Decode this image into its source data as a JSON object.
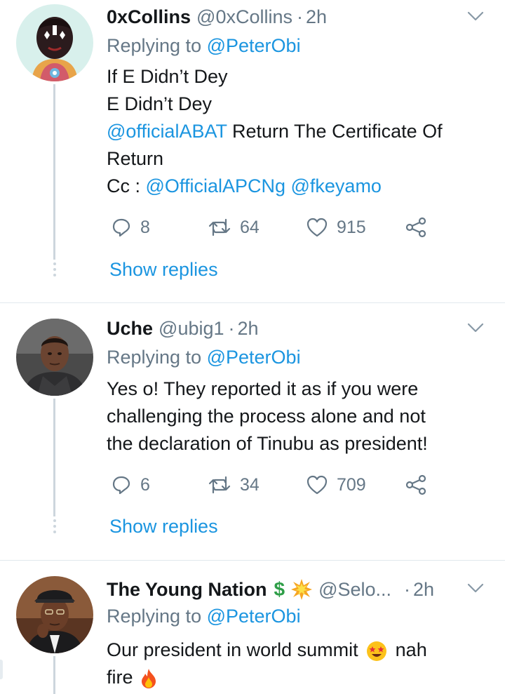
{
  "tweets": [
    {
      "name": "0xCollins",
      "handle": "@0xCollins",
      "sep": "·",
      "time": "2h",
      "replying_prefix": "Replying to",
      "replying_handle": "@PeterObi",
      "lines": [
        [
          {
            "t": "If E Didn’t Dey",
            "link": false
          }
        ],
        [
          {
            "t": "E Didn’t Dey",
            "link": false
          }
        ],
        [
          {
            "t": "@officialABAT",
            "link": true
          },
          {
            "t": " Return The Certificate Of",
            "link": false
          }
        ],
        [
          {
            "t": "Return",
            "link": false
          }
        ],
        [
          {
            "t": "Cc : ",
            "link": false
          },
          {
            "t": "@OfficialAPCNg",
            "link": true
          },
          {
            "t": " ",
            "link": false
          },
          {
            "t": "@fkeyamo",
            "link": true
          }
        ]
      ],
      "replies": "8",
      "retweets": "64",
      "likes": "915",
      "show_replies": "Show replies"
    },
    {
      "name": "Uche",
      "handle": "@ubig1",
      "sep": "·",
      "time": "2h",
      "replying_prefix": "Replying to",
      "replying_handle": "@PeterObi",
      "lines": [
        [
          {
            "t": "Yes o! They reported it as if you were",
            "link": false
          }
        ],
        [
          {
            "t": "challenging the process alone and not",
            "link": false
          }
        ],
        [
          {
            "t": "the declaration of Tinubu as president!",
            "link": false
          }
        ]
      ],
      "replies": "6",
      "retweets": "34",
      "likes": "709",
      "show_replies": "Show replies"
    },
    {
      "name": "The Young Nation",
      "name_emojis": [
        "dollar-sign",
        "collision"
      ],
      "handle": "@Selo...",
      "sep": "·",
      "time": "2h",
      "replying_prefix": "Replying to",
      "replying_handle": "@PeterObi",
      "line1": "Our president in world summit",
      "line1_suffix": "nah",
      "line2": "fire",
      "emojis": [
        "star-struck-face",
        "fire"
      ]
    }
  ],
  "colors": {
    "link": "#1b95e0",
    "muted": "#657786",
    "text": "#14171a",
    "divider": "#e1e8ed",
    "thread": "#cdd6dd"
  }
}
